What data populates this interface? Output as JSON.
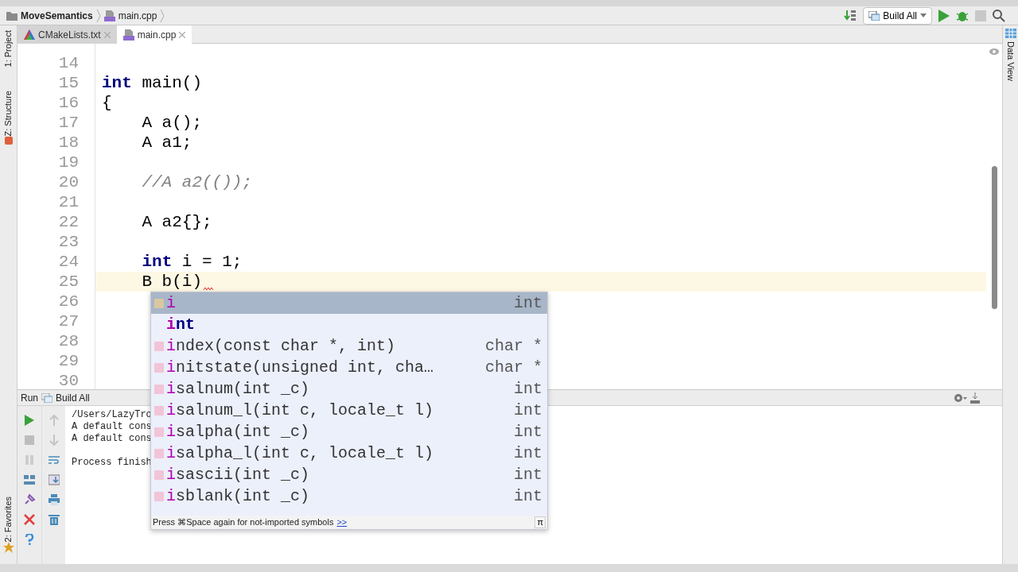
{
  "breadcrumb": [
    {
      "label": "MoveSemantics",
      "kind": "folder"
    },
    {
      "label": "main.cpp",
      "kind": "cpp"
    }
  ],
  "toolbar": {
    "config": "Build All"
  },
  "left_tools": [
    {
      "label": "1: Project"
    },
    {
      "label": "Z: Structure"
    }
  ],
  "bottom_left_tools": [
    {
      "label": "2: Favorites"
    }
  ],
  "right_tools": [
    {
      "label": "Data View"
    }
  ],
  "tabs": [
    {
      "label": "CMakeLists.txt",
      "kind": "cmake",
      "selected": false
    },
    {
      "label": "main.cpp",
      "kind": "cpp",
      "selected": true
    }
  ],
  "editor": {
    "lines": [
      {
        "number": "14",
        "kind": "code",
        "current": false,
        "error": false
      },
      {
        "number": "15",
        "text": "**int** main()",
        "kind": "code",
        "current": false,
        "error": false
      },
      {
        "number": "16",
        "text": "{",
        "kind": "code",
        "current": false,
        "error": false
      },
      {
        "number": "17",
        "text": "    A a();",
        "kind": "code",
        "current": false,
        "error": false
      },
      {
        "number": "18",
        "text": "    A a1;",
        "kind": "code",
        "current": false,
        "error": false
      },
      {
        "number": "19",
        "kind": "code",
        "current": false,
        "error": false
      },
      {
        "number": "20",
        "text": "    //A a2(());",
        "kind": "comment",
        "current": false,
        "error": false
      },
      {
        "number": "21",
        "kind": "code",
        "current": false,
        "error": false
      },
      {
        "number": "22",
        "text": "    A a2{};",
        "kind": "code",
        "current": false,
        "error": false
      },
      {
        "number": "23",
        "kind": "code",
        "current": false,
        "error": false
      },
      {
        "number": "24",
        "text": "    **int** i = 1;",
        "kind": "code",
        "current": false,
        "error": false
      },
      {
        "number": "25",
        "text": "    B b(i)",
        "kind": "code",
        "current": true,
        "error": true
      },
      {
        "number": "26",
        "kind": "code",
        "current": false,
        "error": false
      },
      {
        "number": "27",
        "kind": "code",
        "current": false,
        "error": false
      },
      {
        "number": "28",
        "kind": "code",
        "current": false,
        "error": false
      },
      {
        "number": "29",
        "kind": "code",
        "current": false,
        "error": false
      },
      {
        "number": "30",
        "kind": "code",
        "current": false,
        "error": false
      }
    ]
  },
  "completion": {
    "items": [
      {
        "name": "i",
        "type": "int",
        "kind": "variable",
        "selected": true
      },
      {
        "name": "int",
        "kind": "keyword",
        "selected": false
      },
      {
        "name": "index(const char *, int)",
        "type": "char *",
        "kind": "function",
        "selected": false
      },
      {
        "name": "initstate(unsigned int, cha…",
        "type": "char *",
        "kind": "function",
        "selected": false
      },
      {
        "name": "isalnum(int _c)",
        "type": "int",
        "kind": "function",
        "selected": false
      },
      {
        "name": "isalnum_l(int c, locale_t l)",
        "type": "int",
        "kind": "function",
        "selected": false
      },
      {
        "name": "isalpha(int _c)",
        "type": "int",
        "kind": "function",
        "selected": false
      },
      {
        "name": "isalpha_l(int c, locale_t l)",
        "type": "int",
        "kind": "function",
        "selected": false
      },
      {
        "name": "isascii(int _c)",
        "type": "int",
        "kind": "function",
        "selected": false
      },
      {
        "name": "isblank(int _c)",
        "type": "int",
        "kind": "function",
        "selected": false
      }
    ],
    "hint": "Press ⌘Space again for not-imported symbols",
    "hint_link": ">>",
    "pi": "π"
  },
  "run_panel": {
    "title": "Run",
    "config": "Build All",
    "output_blocks": [
      {
        "lines": [
          "/Users/LazyTro",
          "A default cons",
          "A default cons"
        ]
      },
      {
        "lines": [
          "Process finish"
        ]
      }
    ]
  }
}
